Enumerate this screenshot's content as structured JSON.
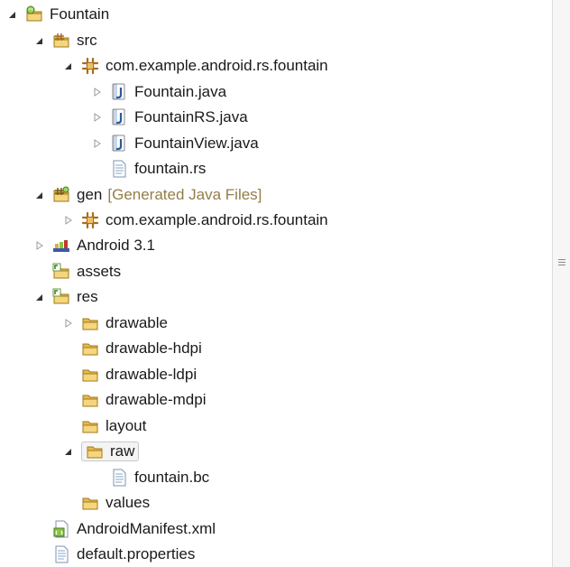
{
  "tree": {
    "rows": [
      {
        "id": "fountain",
        "label": "Fountain",
        "level": 0,
        "toggle": "expanded",
        "icon": "android-project-icon"
      },
      {
        "id": "src",
        "label": "src",
        "level": 1,
        "toggle": "expanded",
        "icon": "source-folder-icon"
      },
      {
        "id": "src-pkg",
        "label": "com.example.android.rs.fountain",
        "level": 2,
        "toggle": "expanded",
        "icon": "package-icon"
      },
      {
        "id": "fountain-java",
        "label": "Fountain.java",
        "level": 3,
        "toggle": "collapsed",
        "icon": "java-file-icon"
      },
      {
        "id": "fountainrs-java",
        "label": "FountainRS.java",
        "level": 3,
        "toggle": "collapsed",
        "icon": "java-file-icon"
      },
      {
        "id": "fountainview-java",
        "label": "FountainView.java",
        "level": 3,
        "toggle": "collapsed",
        "icon": "java-file-icon"
      },
      {
        "id": "fountain-rs",
        "label": "fountain.rs",
        "level": 3,
        "toggle": "none",
        "icon": "text-file-icon"
      },
      {
        "id": "gen",
        "label": "gen",
        "decoration": "[Generated Java Files]",
        "level": 1,
        "toggle": "expanded",
        "icon": "generated-folder-icon"
      },
      {
        "id": "gen-pkg",
        "label": "com.example.android.rs.fountain",
        "level": 2,
        "toggle": "collapsed",
        "icon": "package-icon"
      },
      {
        "id": "android31",
        "label": "Android 3.1",
        "level": 1,
        "toggle": "collapsed",
        "icon": "library-icon"
      },
      {
        "id": "assets",
        "label": "assets",
        "level": 1,
        "toggle": "none",
        "icon": "resource-folder-icon"
      },
      {
        "id": "res",
        "label": "res",
        "level": 1,
        "toggle": "expanded",
        "icon": "resource-folder-icon"
      },
      {
        "id": "drawable",
        "label": "drawable",
        "level": 2,
        "toggle": "collapsed",
        "icon": "folder-icon"
      },
      {
        "id": "drawable-hdpi",
        "label": "drawable-hdpi",
        "level": 2,
        "toggle": "none",
        "icon": "folder-icon"
      },
      {
        "id": "drawable-ldpi",
        "label": "drawable-ldpi",
        "level": 2,
        "toggle": "none",
        "icon": "folder-icon"
      },
      {
        "id": "drawable-mdpi",
        "label": "drawable-mdpi",
        "level": 2,
        "toggle": "none",
        "icon": "folder-icon"
      },
      {
        "id": "layout",
        "label": "layout",
        "level": 2,
        "toggle": "none",
        "icon": "folder-icon"
      },
      {
        "id": "raw",
        "label": "raw",
        "level": 2,
        "toggle": "expanded",
        "icon": "folder-icon",
        "selected": true
      },
      {
        "id": "fountain-bc",
        "label": "fountain.bc",
        "level": 3,
        "toggle": "none",
        "icon": "text-file-icon"
      },
      {
        "id": "values",
        "label": "values",
        "level": 2,
        "toggle": "none",
        "icon": "folder-icon"
      },
      {
        "id": "manifest",
        "label": "AndroidManifest.xml",
        "level": 1,
        "toggle": "none",
        "icon": "xml-file-icon"
      },
      {
        "id": "default-properties",
        "label": "default.properties",
        "level": 1,
        "toggle": "none",
        "icon": "text-file-icon"
      }
    ]
  },
  "colors": {
    "folder": "#e8b94a",
    "package": "#a86d1f",
    "decoration": "#957d47",
    "java": "#2b5b9c"
  }
}
